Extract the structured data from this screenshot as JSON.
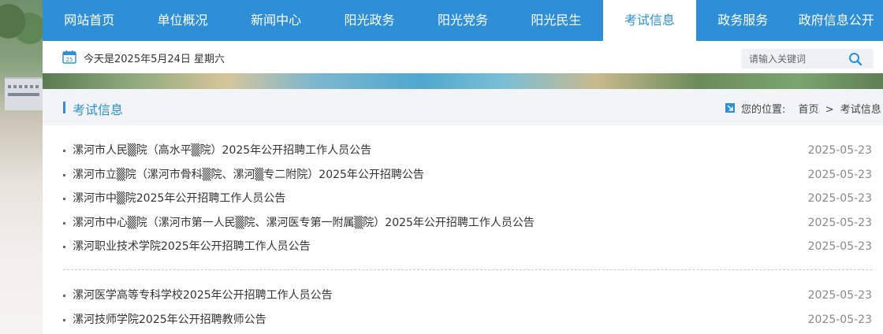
{
  "nav": {
    "items": [
      {
        "label": "网站首页",
        "active": false
      },
      {
        "label": "单位概况",
        "active": false
      },
      {
        "label": "新闻中心",
        "active": false
      },
      {
        "label": "阳光政务",
        "active": false
      },
      {
        "label": "阳光党务",
        "active": false
      },
      {
        "label": "阳光民生",
        "active": false
      },
      {
        "label": "考试信息",
        "active": true
      },
      {
        "label": "政务服务",
        "active": false
      },
      {
        "label": "政府信息公开",
        "active": false
      }
    ]
  },
  "infobar": {
    "calendar_day": "25",
    "date_text": "今天是2025年5月24日 星期六",
    "search_placeholder": "请输入关键词"
  },
  "section": {
    "title": "考试信息",
    "location_label": "您的位置:",
    "breadcrumb": [
      "首页",
      "考试信息"
    ],
    "breadcrumb_sep": ">"
  },
  "articles_group1": [
    {
      "title": "漯河市人民▒院（高水平▒院）2025年公开招聘工作人员公告",
      "date": "2025-05-23"
    },
    {
      "title": "漯河市立▒院（漯河市骨科▒院、漯河▒专二附院）2025年公开招聘公告",
      "date": "2025-05-23"
    },
    {
      "title": "漯河市中▒院2025年公开招聘工作人员公告",
      "date": "2025-05-23"
    },
    {
      "title": "漯河市中心▒院（漯河市第一人民▒院、漯河医专第一附属▒院）2025年公开招聘工作人员公告",
      "date": "2025-05-23"
    },
    {
      "title": "漯河职业技术学院2025年公开招聘工作人员公告",
      "date": "2025-05-23"
    }
  ],
  "articles_group2": [
    {
      "title": "漯河医学高等专科学校2025年公开招聘工作人员公告",
      "date": "2025-05-23"
    },
    {
      "title": "漯河技师学院2025年公开招聘教师公告",
      "date": "2025-05-23"
    }
  ],
  "colors": {
    "brand": "#2e8fd6",
    "text": "#333333",
    "date": "#888888",
    "panel_head": "#f2f4f7"
  },
  "icons": {
    "calendar": "calendar-icon",
    "search": "search-icon",
    "location": "location-arrow-icon"
  }
}
